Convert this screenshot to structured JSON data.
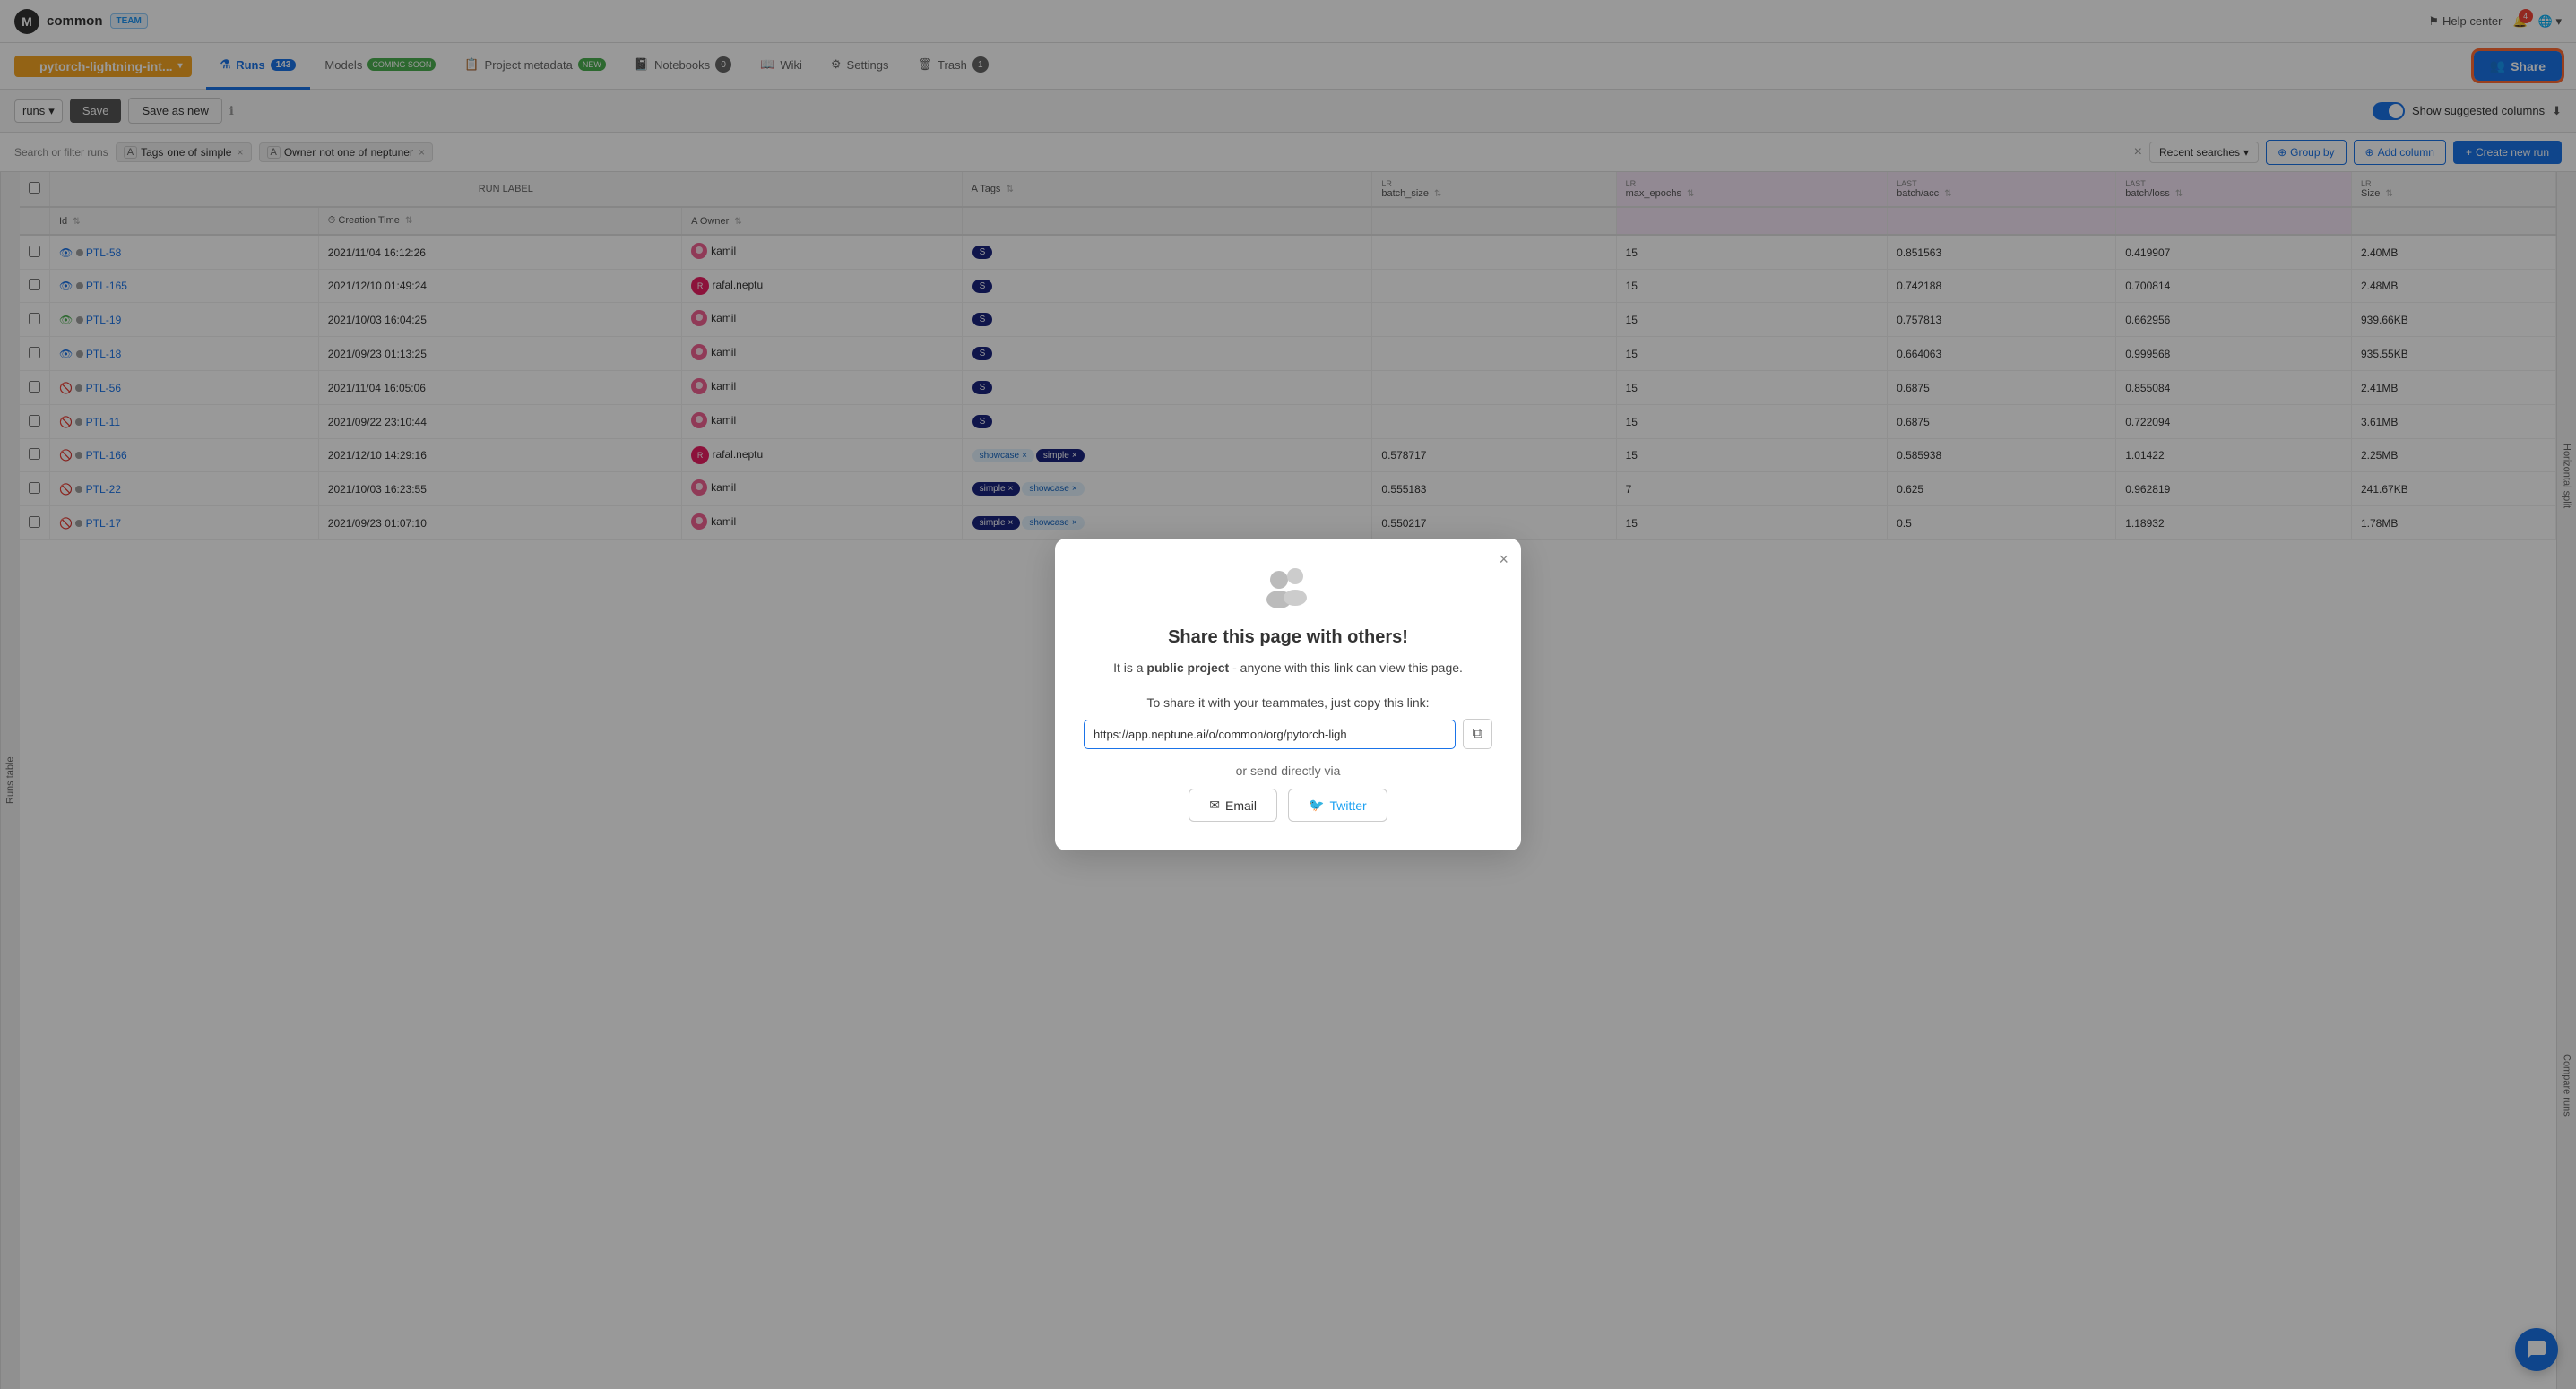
{
  "app": {
    "logo_text": "M",
    "org_name": "common",
    "team_badge": "TEAM"
  },
  "topbar": {
    "help_center": "Help center",
    "notif_count": "4",
    "globe_label": "Globe"
  },
  "project": {
    "name": "pytorch-lightning-int...",
    "chevron": "▾"
  },
  "tabs": [
    {
      "id": "runs",
      "label": "Runs",
      "badge": "143",
      "active": true,
      "icon": "⚗"
    },
    {
      "id": "models",
      "label": "Models",
      "extra": "COMING SOON",
      "active": false,
      "icon": ""
    },
    {
      "id": "project-metadata",
      "label": "Project metadata",
      "extra": "NEW",
      "active": false,
      "icon": "📋"
    },
    {
      "id": "notebooks",
      "label": "Notebooks",
      "count": "0",
      "active": false,
      "icon": "📓"
    },
    {
      "id": "wiki",
      "label": "Wiki",
      "active": false,
      "icon": "📖"
    },
    {
      "id": "settings",
      "label": "Settings",
      "active": false,
      "icon": "⚙"
    },
    {
      "id": "trash",
      "label": "Trash",
      "count": "1",
      "active": false,
      "icon": "🗑"
    }
  ],
  "share_button": "Share",
  "toolbar": {
    "runs_label": "runs",
    "save_label": "Save",
    "save_as_label": "Save as new",
    "show_suggested": "Show suggested columns"
  },
  "filter": {
    "placeholder": "Search or filter runs",
    "tags_label": "Tags",
    "one_of": "one of",
    "tag_value": "simple",
    "owner_label": "Owner",
    "not_one_of": "not one of",
    "owner_value": "neptuner",
    "recent_searches": "Recent searches",
    "group_by": "Group by",
    "add_column": "Add column",
    "create_new_run": "Create new run"
  },
  "columns": {
    "run_label": "RUN LABEL",
    "id": "Id",
    "creation_time": "Creation Time",
    "owner": "Owner",
    "tags": "Tags",
    "batch_size": "batch_size",
    "max_epochs": "max_epochs",
    "batch_acc": "batch/acc",
    "batch_loss": "batch/loss",
    "size": "Size",
    "last_label_batch_acc": "LAST",
    "last_label_batch_loss": "LAST"
  },
  "runs": [
    {
      "id": "PTL-58",
      "time": "2021/11/04 16:12:26",
      "owner": "kamil",
      "tags": [
        "S"
      ],
      "batch_size": "",
      "max_epochs": "15",
      "batch_acc": "0.851563",
      "batch_loss": "0.419907",
      "size": "2.40MB",
      "visibility": "eye",
      "status": "gray"
    },
    {
      "id": "PTL-165",
      "time": "2021/12/10 01:49:24",
      "owner": "rafal.neptu",
      "tags": [
        "S"
      ],
      "batch_size": "",
      "max_epochs": "15",
      "batch_acc": "0.742188",
      "batch_loss": "0.700814",
      "size": "2.48MB",
      "visibility": "eye",
      "status": "gray"
    },
    {
      "id": "PTL-19",
      "time": "2021/10/03 16:04:25",
      "owner": "kamil",
      "tags": [
        "S"
      ],
      "batch_size": "",
      "max_epochs": "15",
      "batch_acc": "0.757813",
      "batch_loss": "0.662956",
      "size": "939.66KB",
      "visibility": "eye-green",
      "status": "gray"
    },
    {
      "id": "PTL-18",
      "time": "2021/09/23 01:13:25",
      "owner": "kamil",
      "tags": [
        "S"
      ],
      "batch_size": "",
      "max_epochs": "15",
      "batch_acc": "0.664063",
      "batch_loss": "0.999568",
      "size": "935.55KB",
      "visibility": "eye",
      "status": "gray"
    },
    {
      "id": "PTL-56",
      "time": "2021/11/04 16:05:06",
      "owner": "kamil",
      "tags": [
        "S"
      ],
      "batch_size": "",
      "max_epochs": "15",
      "batch_acc": "0.6875",
      "batch_loss": "0.855084",
      "size": "2.41MB",
      "visibility": "hidden",
      "status": "gray"
    },
    {
      "id": "PTL-11",
      "time": "2021/09/22 23:10:44",
      "owner": "kamil",
      "tags": [
        "S"
      ],
      "batch_size": "",
      "max_epochs": "15",
      "batch_acc": "0.6875",
      "batch_loss": "0.722094",
      "size": "3.61MB",
      "visibility": "hidden",
      "status": "gray"
    },
    {
      "id": "PTL-166",
      "time": "2021/12/10 14:29:16",
      "owner": "rafal.neptu",
      "tags": [
        "showcase",
        "simple"
      ],
      "batch_size": "0.578717",
      "max_epochs": "15",
      "batch_acc": "0.585938",
      "batch_loss": "1.01422",
      "size": "2.25MB",
      "visibility": "hidden",
      "status": "gray"
    },
    {
      "id": "PTL-22",
      "time": "2021/10/03 16:23:55",
      "owner": "kamil",
      "tags": [
        "simple",
        "showcase"
      ],
      "batch_size": "0.555183",
      "max_epochs": "7",
      "batch_acc": "0.625",
      "batch_loss": "0.962819",
      "size": "241.67KB",
      "visibility": "hidden",
      "status": "gray"
    },
    {
      "id": "PTL-17",
      "time": "2021/09/23 01:07:10",
      "owner": "kamil",
      "tags": [
        "simple",
        "showcase"
      ],
      "batch_size": "0.550217",
      "max_epochs": "15",
      "batch_acc": "0.5",
      "batch_loss": "1.18932",
      "size": "1.78MB",
      "visibility": "hidden",
      "status": "gray"
    }
  ],
  "modal": {
    "title": "Share this page with others!",
    "description_part1": "It is a ",
    "description_bold": "public project",
    "description_part2": " - anyone with this link can view this page.",
    "share_label": "To share it with your teammates, just copy this link:",
    "link_url": "https://app.neptune.ai/o/common/org/pytorch-ligh",
    "or_text": "or send directly via",
    "email_label": "Email",
    "twitter_label": "Twitter"
  },
  "side_labels": {
    "runs_table": "Runs table",
    "horizontal_split": "Horizontal split",
    "compare_runs": "Compare runs"
  }
}
